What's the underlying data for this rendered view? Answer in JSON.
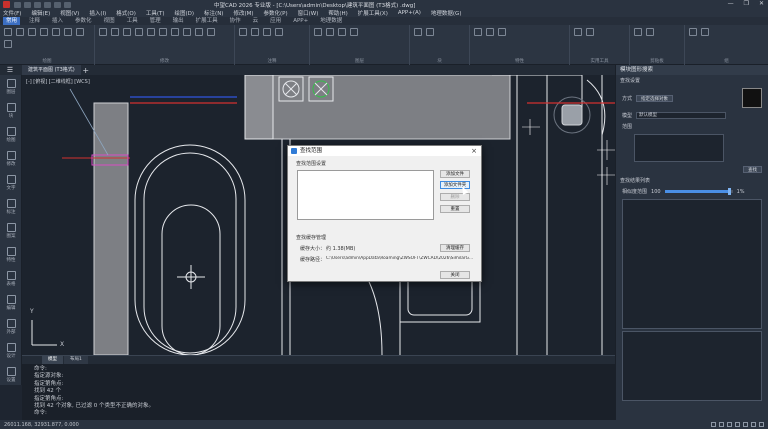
{
  "window": {
    "title": "中望CAD 2026 专业版 - [C:\\Users\\admin\\Desktop\\建筑平面图 (T3格式) .dwg]",
    "controls": [
      "—",
      "❐",
      "✕"
    ]
  },
  "menubar": [
    "文件(F)",
    "编辑(E)",
    "视图(V)",
    "插入(I)",
    "格式(O)",
    "工具(T)",
    "绘图(D)",
    "标注(N)",
    "修改(M)",
    "参数化(P)",
    "窗口(W)",
    "帮助(H)",
    "扩展工具(X)",
    "APP+(A)",
    "地理数据(G)"
  ],
  "ribbon_tabs": [
    "常用",
    "注释",
    "插入",
    "参数化",
    "视图",
    "工具",
    "管理",
    "输出",
    "扩展工具",
    "协作",
    "云",
    "应用",
    "APP+",
    "地理数据"
  ],
  "ribbon_groups": [
    "绘图",
    "修改",
    "注释",
    "图层",
    "块",
    "特性",
    "实用工具",
    "剪贴板",
    "组"
  ],
  "doc_tab": "建筑平面图 (T3格式)",
  "view_label": "[-] [俯视] [二维线框] [WCS]",
  "left_tools": [
    "图层",
    "块",
    "绘图",
    "修改",
    "文字",
    "标注",
    "图案",
    "特性",
    "表格",
    "编辑",
    "外部",
    "设计",
    "打印",
    "布局",
    "设置"
  ],
  "right_panel": {
    "title": "模块图形搜索",
    "section_search": "查找设置",
    "pick_label": "方式",
    "pick_button": "指定选择对象",
    "mode_label": "模型",
    "mode_value": "默认模型",
    "range_label": "范围",
    "search_button": "查找",
    "similarity_section": "查找结果列表",
    "similarity_label": "相似度范围",
    "similarity_min": "100",
    "similarity_max": "1%",
    "slider_fraction": 0.95
  },
  "dialog": {
    "title": "查找范围",
    "group_scope": "查找范围设置",
    "btn_add_file": "添加文件",
    "btn_add_folder": "添加文件夹",
    "btn_delete": "删除",
    "btn_reset": "重置",
    "group_cache": "查找缓存管理",
    "cache_size_label": "缓存大小：",
    "cache_size_value": "约 1.38(MB)",
    "btn_clear_cache": "清理缓存",
    "cache_path_label": "缓存路径：",
    "cache_path_value": "C:\\Users\\admin\\AppData\\Roaming\\ZWSOFT\\ZWCAD\\2026\\SimilarG...",
    "btn_close": "关闭"
  },
  "layout_tabs": [
    "模型",
    "布局1"
  ],
  "command_lines": [
    "命令:",
    "指定源对象:",
    "指定第角点:",
    "找到 42 个",
    "指定第角点:",
    "找到 42 个对象, 已过滤 0 个类型不正确的对象。",
    "命令:"
  ],
  "status": {
    "coords": "26011.168, 32931.877, 0.000"
  },
  "axis": {
    "y": "Y",
    "x": "X"
  }
}
